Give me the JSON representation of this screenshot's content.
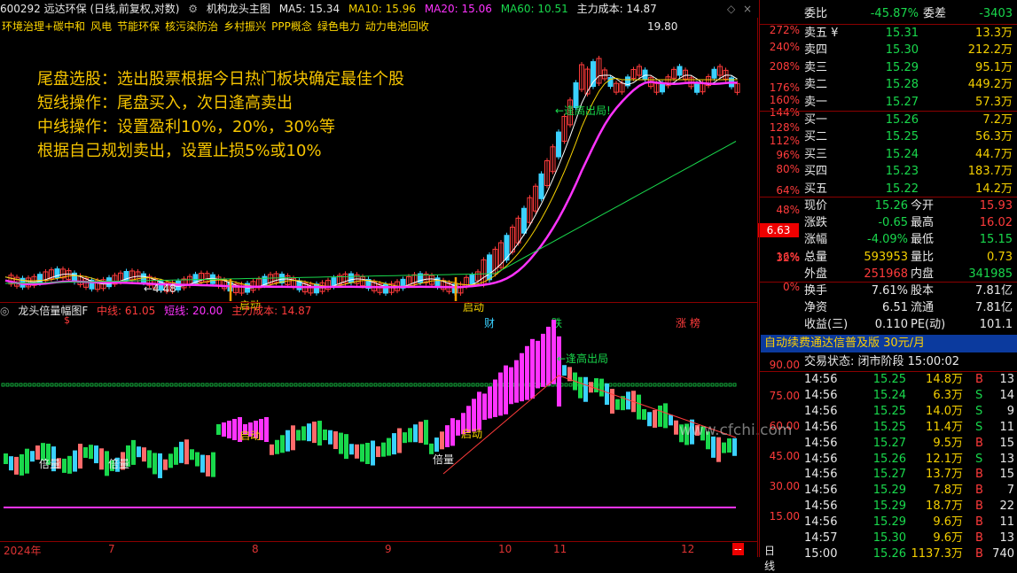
{
  "header": {
    "stock_code": "600292 远达环保 (日线,前复权,对数)",
    "main_indicator": "机构龙头主图",
    "ma5": "MA5: 15.34",
    "ma10": "MA10: 15.96",
    "ma20": "MA20: 15.06",
    "ma60": "MA60: 10.51",
    "main_cost": "主力成本: 14.87"
  },
  "concepts": [
    "环境治理+碳中和",
    "风电",
    "节能环保",
    "核污染防治",
    "乡村振兴",
    "PPP概念",
    "绿色电力",
    "动力电池回收"
  ],
  "notes": [
    "尾盘选股：选出股票根据今日热门板块确定最佳个股",
    "短线操作：尾盘买入，次日逢高卖出",
    "中线操作：设置盈利10%，20%，30%等",
    "根据自己规划卖出，设置止损5%或10%"
  ],
  "price_axis": [
    "272%",
    "240%",
    "208%",
    "176%",
    "160%",
    "144%",
    "128%",
    "112%",
    "96%",
    "80%",
    "64%",
    "48%",
    "32%",
    "16%",
    "0%"
  ],
  "current_price_tag": "6.63",
  "chart_labels": {
    "high_label": "19.80",
    "low_label": "←4.48",
    "start1": "启动",
    "start2": "启动",
    "top_out": "←逢高出局!",
    "event1": "财",
    "event2": "跌",
    "event3": "涨 榜",
    "event_s": "$"
  },
  "indicator": {
    "title": "龙头倍量幅图F",
    "mid_line": "中线: 61.05",
    "short_line": "短线: 20.00",
    "main_cost": "主力成本: 14.87",
    "axis": [
      "90.00",
      "75.00",
      "60.00",
      "45.00",
      "30.00",
      "15.00"
    ],
    "labels": {
      "bei1": "倍量",
      "bei2": "倍量",
      "bei3": "倍量",
      "qd1": "启动",
      "qd2": "启动",
      "top": "←逢高出局"
    }
  },
  "time_axis": [
    "2024年",
    "7",
    "8",
    "9",
    "10",
    "11",
    "12",
    "--"
  ],
  "period": "日线",
  "watermark": "www.cfchi.com",
  "order_book": {
    "weibi_label": "委比",
    "weibi": "-45.87%",
    "weicha_label": "委差",
    "weicha": "-3403",
    "asks": [
      {
        "label": "卖五 ¥",
        "price": "15.31",
        "vol": "13.3万"
      },
      {
        "label": "卖四",
        "price": "15.30",
        "vol": "212.2万"
      },
      {
        "label": "卖三",
        "price": "15.29",
        "vol": "95.1万"
      },
      {
        "label": "卖二",
        "price": "15.28",
        "vol": "449.2万"
      },
      {
        "label": "卖一",
        "price": "15.27",
        "vol": "57.3万"
      }
    ],
    "bids": [
      {
        "label": "买一",
        "price": "15.26",
        "vol": "7.2万"
      },
      {
        "label": "买二",
        "price": "15.25",
        "vol": "56.3万"
      },
      {
        "label": "买三",
        "price": "15.24",
        "vol": "44.7万"
      },
      {
        "label": "买四",
        "price": "15.23",
        "vol": "183.7万"
      },
      {
        "label": "买五",
        "price": "15.22",
        "vol": "14.2万"
      }
    ]
  },
  "quote": {
    "rows": [
      {
        "l1": "现价",
        "v1": "15.26",
        "l2": "今开",
        "v2": "15.93",
        "c1": "green",
        "c2": "red"
      },
      {
        "l1": "涨跌",
        "v1": "-0.65",
        "l2": "最高",
        "v2": "16.02",
        "c1": "green",
        "c2": "red"
      },
      {
        "l1": "涨幅",
        "v1": "-4.09%",
        "l2": "最低",
        "v2": "15.15",
        "c1": "green",
        "c2": "green"
      },
      {
        "l1": "总量",
        "v1": "593953",
        "l2": "量比",
        "v2": "0.73",
        "c1": "yellow",
        "c2": "yellow"
      },
      {
        "l1": "外盘",
        "v1": "251968",
        "l2": "内盘",
        "v2": "341985",
        "c1": "red",
        "c2": "green"
      }
    ],
    "rows2": [
      {
        "l1": "换手",
        "v1": "7.61%",
        "l2": "股本",
        "v2": "7.81亿"
      },
      {
        "l1": "净资",
        "v1": "6.51",
        "l2": "流通",
        "v2": "7.81亿"
      },
      {
        "l1": "收益(三)",
        "v1": "0.110",
        "l2": "PE(动)",
        "v2": "101.1"
      }
    ]
  },
  "promo": "自动续费通达信普及版  30元/月",
  "trade_status": "交易状态: 闭市阶段 15:00:02",
  "ticks": [
    {
      "t": "14:56",
      "p": "15.25",
      "v": "14.8万",
      "d": "B",
      "n": "13"
    },
    {
      "t": "14:56",
      "p": "15.24",
      "v": "6.3万",
      "d": "S",
      "n": "14"
    },
    {
      "t": "14:56",
      "p": "15.25",
      "v": "14.0万",
      "d": "S",
      "n": "9"
    },
    {
      "t": "14:56",
      "p": "15.25",
      "v": "11.4万",
      "d": "S",
      "n": "11"
    },
    {
      "t": "14:56",
      "p": "15.27",
      "v": "9.5万",
      "d": "B",
      "n": "15"
    },
    {
      "t": "14:56",
      "p": "15.26",
      "v": "12.1万",
      "d": "S",
      "n": "13"
    },
    {
      "t": "14:56",
      "p": "15.27",
      "v": "13.7万",
      "d": "B",
      "n": "15"
    },
    {
      "t": "14:56",
      "p": "15.29",
      "v": "7.8万",
      "d": "B",
      "n": "7"
    },
    {
      "t": "14:56",
      "p": "15.29",
      "v": "18.7万",
      "d": "B",
      "n": "22"
    },
    {
      "t": "14:56",
      "p": "15.29",
      "v": "9.6万",
      "d": "B",
      "n": "11"
    },
    {
      "t": "14:57",
      "p": "15.30",
      "v": "9.6万",
      "d": "B",
      "n": "13"
    },
    {
      "t": "15:00",
      "p": "15.26",
      "v": "1137.3万",
      "d": "B",
      "n": "740"
    }
  ]
}
